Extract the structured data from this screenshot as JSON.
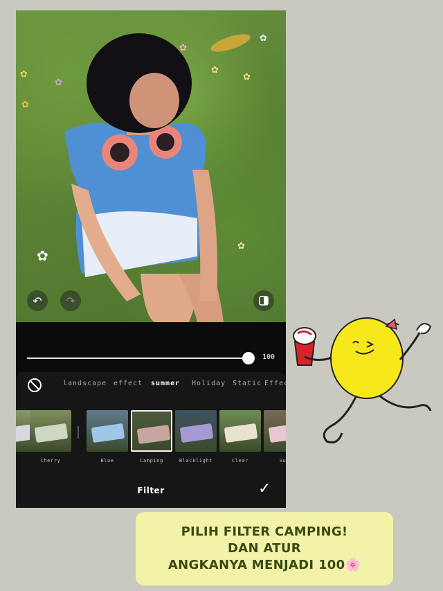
{
  "editor": {
    "slider": {
      "value": 100,
      "value_label": "100"
    },
    "categories": [
      "landscape",
      "effect",
      "summer",
      "Holiday",
      "Static",
      "Effect"
    ],
    "active_category": "summer",
    "filters": [
      {
        "label": "",
        "tone": "#8a9a6c"
      },
      {
        "label": "Cherry",
        "tone": "#7f8f5c"
      },
      {
        "label": "Blue",
        "tone": "#5e7c8c"
      },
      {
        "label": "Camping",
        "tone": "#4b5a3a"
      },
      {
        "label": "Blacklight",
        "tone": "#3f5260"
      },
      {
        "label": "Clear",
        "tone": "#6f8c55"
      },
      {
        "label": "Sun",
        "tone": "#7a6b55"
      }
    ],
    "selected_filter": "Camping",
    "bottom_title": "Filter",
    "icons": {
      "undo": "undo-icon",
      "redo": "redo-icon",
      "compare": "compare-icon",
      "no_filter": "no-filter-icon",
      "confirm": "checkmark-icon"
    }
  },
  "caption": {
    "line1": "PILIH FILTER CAMPING!",
    "line2": "DAN ATUR",
    "line3": "ANGKANYA MENJADI 100🌸"
  },
  "colors": {
    "caption_bg": "#f2f2a8",
    "caption_text": "#3a4a14",
    "sticker_lemon": "#f7e81c"
  }
}
